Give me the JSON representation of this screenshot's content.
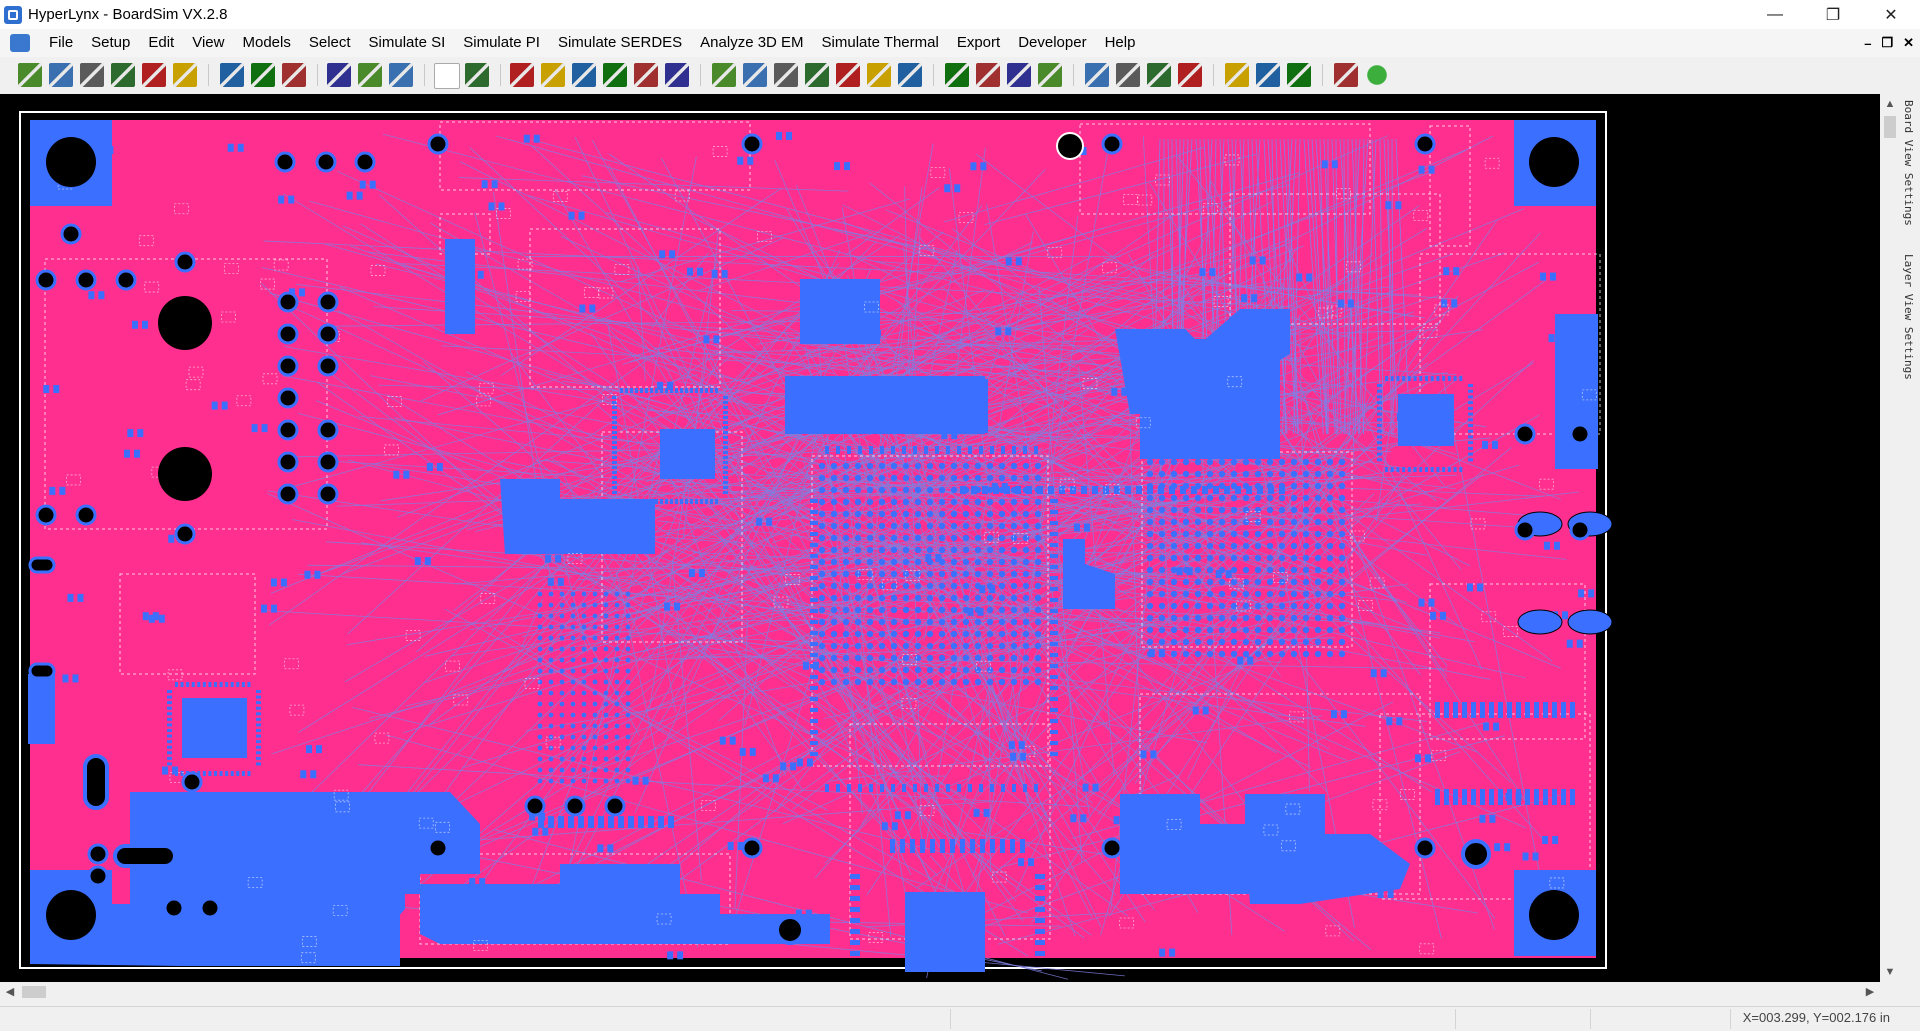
{
  "window": {
    "title": "HyperLynx - BoardSim VX.2.8",
    "minimize": "—",
    "restore": "❐",
    "close": "✕"
  },
  "menu": {
    "items": [
      "File",
      "Setup",
      "Edit",
      "View",
      "Models",
      "Select",
      "Simulate SI",
      "Simulate PI",
      "Simulate SERDES",
      "Analyze 3D EM",
      "Simulate Thermal",
      "Export",
      "Developer",
      "Help"
    ],
    "mdi_minimize": "–",
    "mdi_restore": "❐",
    "mdi_close": "✕"
  },
  "toolbar": {
    "icons": [
      "open-board-icon",
      "open-icon",
      "save-icon",
      "print-icon",
      "copy-icon",
      "edit-icon",
      "layer-stackup-icon",
      "zoom-in-icon",
      "zoom-out-icon",
      "fit-board-icon",
      "select-nets-icon",
      "probe-icon",
      "blank-icon",
      "netlist-icon",
      "ibis-icon",
      "terminator-icon",
      "eye-icon",
      "component-icon",
      "stackup-icon",
      "waveform-icon",
      "crosstalk-icon",
      "route-icon",
      "scope-icon",
      "scope-2-icon",
      "scope-3-icon",
      "scope-4-icon",
      "scope-5-icon",
      "scope-6-icon",
      "bar-chart-icon",
      "report-icon",
      "ddr-icon",
      "plot-icon",
      "plot-2-icon",
      "plot-3-icon",
      "plot-4-icon",
      "thermal-map-icon",
      "pi-icon",
      "dc-drop-icon",
      "thermometer-icon",
      "help-icon"
    ]
  },
  "side_panel": {
    "board_view_settings": "Board View Settings",
    "layer_view_settings": "Layer View Settings"
  },
  "status": {
    "coords": "X=003.299, Y=002.176 in"
  },
  "colors": {
    "board": "#ff2f8f",
    "copper": "#3b6fff",
    "background": "#000000"
  }
}
